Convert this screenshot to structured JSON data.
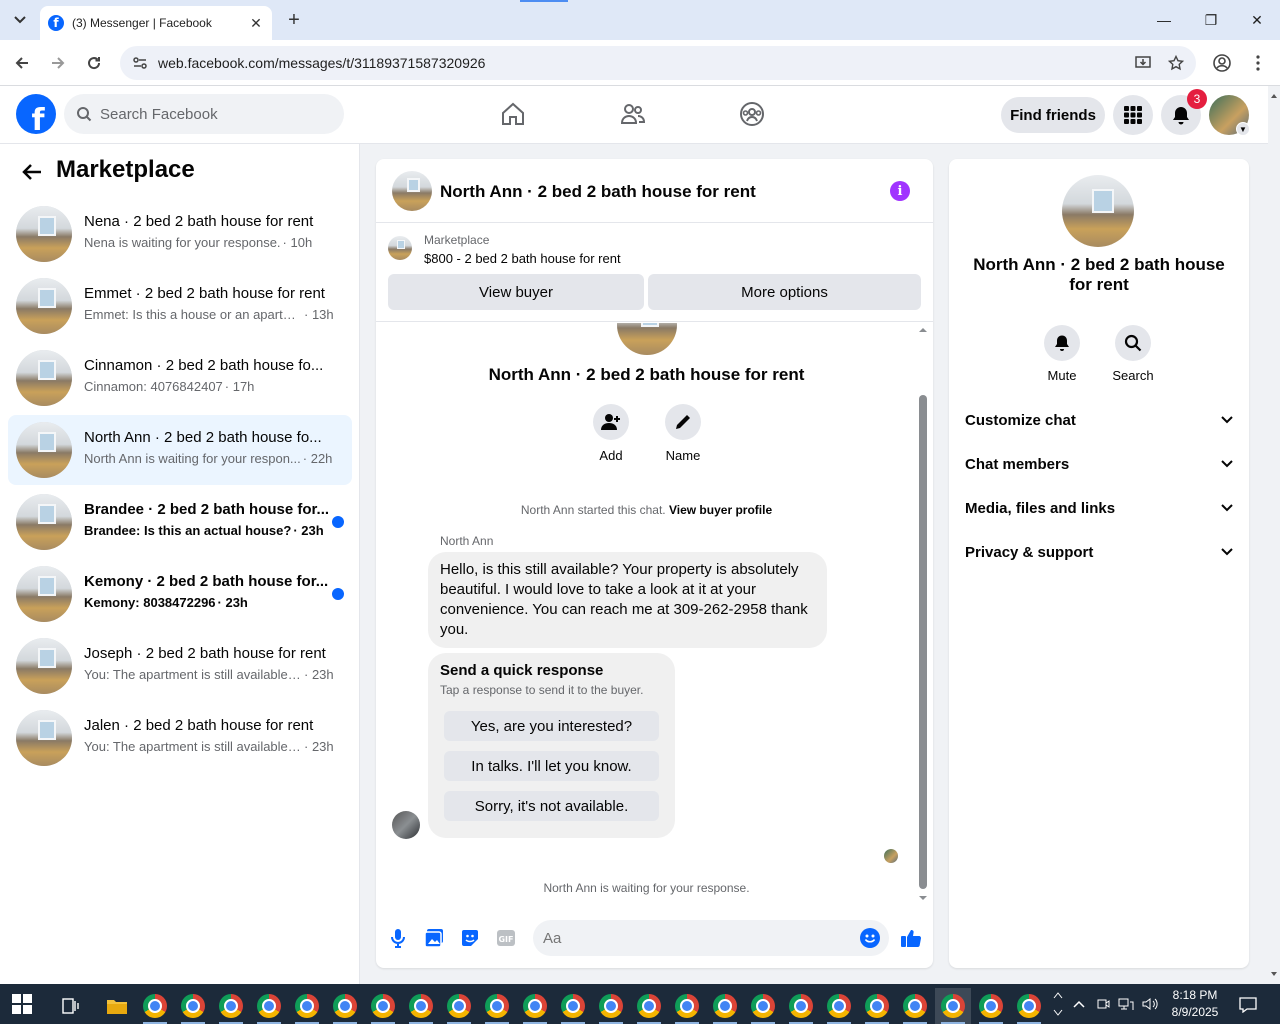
{
  "browser": {
    "tab_title": "(3) Messenger | Facebook",
    "url": "web.facebook.com/messages/t/31189371587320926"
  },
  "fb": {
    "search_placeholder": "Search Facebook",
    "find_friends": "Find friends",
    "notification_count": "3"
  },
  "sidebar": {
    "title": "Marketplace",
    "conversations": [
      {
        "name": "Nena · 2 bed 2 bath house for rent",
        "preview": "Nena is waiting for your response.",
        "time": "· 10h",
        "unread": false,
        "active": false
      },
      {
        "name": "Emmet · 2 bed 2 bath house for rent",
        "preview": "Emmet: Is this a house or an apartm...",
        "time": "· 13h",
        "unread": false,
        "active": false
      },
      {
        "name": "Cinnamon · 2 bed 2 bath house fo...",
        "preview": "Cinnamon: 4076842407",
        "time": "· 17h",
        "unread": false,
        "active": false
      },
      {
        "name": "North Ann · 2 bed 2 bath house fo...",
        "preview": "North Ann is waiting for your respon...",
        "time": "· 22h",
        "unread": false,
        "active": true
      },
      {
        "name": "Brandee · 2 bed 2 bath house for...",
        "preview": "Brandee: Is this an actual house?",
        "time": "· 23h",
        "unread": true,
        "active": false
      },
      {
        "name": "Kemony · 2 bed 2 bath house for...",
        "preview": "Kemony: 8038472296",
        "time": "· 23h",
        "unread": true,
        "active": false
      },
      {
        "name": "Joseph · 2 bed 2 bath house for rent",
        "preview": "You: The apartment is still available f...",
        "time": "· 23h",
        "unread": false,
        "active": false
      },
      {
        "name": "Jalen · 2 bed 2 bath house for rent",
        "preview": "You: The apartment is still available f...",
        "time": "· 23h",
        "unread": false,
        "active": false
      }
    ]
  },
  "chat": {
    "title": "North Ann · 2 bed 2 bath house for rent",
    "listing_source": "Marketplace",
    "listing_price": "$800 - 2 bed 2 bath house for rent",
    "view_buyer": "View buyer",
    "more_options": "More options",
    "thread_title": "North Ann · 2 bed 2 bath house for rent",
    "add_label": "Add",
    "name_label": "Name",
    "started_note": "North Ann started this chat.",
    "view_buyer_profile": "View buyer profile",
    "sender": "North Ann",
    "message": "Hello, is this still available? Your property is absolutely beautiful. I would love to take a look at it at your convenience. You can reach me at 309-262-2958 thank you.",
    "quick_title": "Send a quick response",
    "quick_sub": "Tap a response to send it to the buyer.",
    "quick_replies": [
      "Yes, are you interested?",
      "In talks. I'll let you know.",
      "Sorry, it's not available."
    ],
    "waiting_note": "North Ann is waiting for your response.",
    "composer_placeholder": "Aa"
  },
  "details": {
    "title": "North Ann · 2 bed 2 bath house for rent",
    "mute": "Mute",
    "search": "Search",
    "sections": [
      "Customize chat",
      "Chat members",
      "Media, files and links",
      "Privacy & support"
    ]
  },
  "taskbar": {
    "time": "8:18 PM",
    "date": "8/9/2025"
  },
  "colors": {
    "fb_blue": "#0866ff",
    "active_row": "#ebf5ff",
    "info_purple": "#a033ff",
    "badge_red": "#e41e3f"
  }
}
